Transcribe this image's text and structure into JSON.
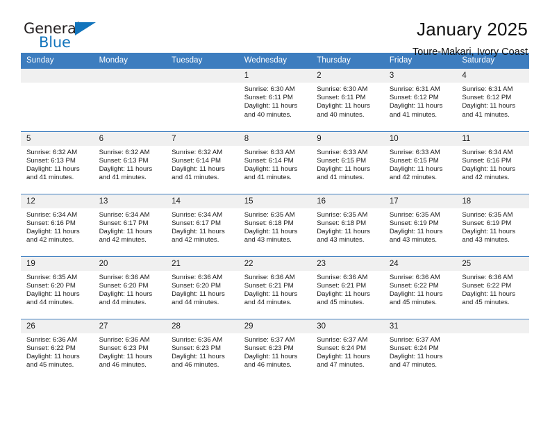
{
  "brand": {
    "name_part1": "General",
    "name_part2": "Blue",
    "accent_color": "#1274bc"
  },
  "header": {
    "title": "January 2025",
    "subtitle": "Toure-Makari, Ivory Coast"
  },
  "theme": {
    "header_row_bg": "#3d7dbf",
    "daynum_bg": "#f0f0f0",
    "grid_line": "#3d7dbf"
  },
  "weekdays": [
    "Sunday",
    "Monday",
    "Tuesday",
    "Wednesday",
    "Thursday",
    "Friday",
    "Saturday"
  ],
  "labels": {
    "sunrise_prefix": "Sunrise:",
    "sunset_prefix": "Sunset:",
    "daylight_prefix": "Daylight:"
  },
  "weeks": [
    [
      {
        "day": "",
        "blank": true
      },
      {
        "day": "",
        "blank": true
      },
      {
        "day": "",
        "blank": true
      },
      {
        "day": "1",
        "sunrise": "Sunrise: 6:30 AM",
        "sunset": "Sunset: 6:11 PM",
        "daylight": "Daylight: 11 hours and 40 minutes."
      },
      {
        "day": "2",
        "sunrise": "Sunrise: 6:30 AM",
        "sunset": "Sunset: 6:11 PM",
        "daylight": "Daylight: 11 hours and 40 minutes."
      },
      {
        "day": "3",
        "sunrise": "Sunrise: 6:31 AM",
        "sunset": "Sunset: 6:12 PM",
        "daylight": "Daylight: 11 hours and 41 minutes."
      },
      {
        "day": "4",
        "sunrise": "Sunrise: 6:31 AM",
        "sunset": "Sunset: 6:12 PM",
        "daylight": "Daylight: 11 hours and 41 minutes."
      }
    ],
    [
      {
        "day": "5",
        "sunrise": "Sunrise: 6:32 AM",
        "sunset": "Sunset: 6:13 PM",
        "daylight": "Daylight: 11 hours and 41 minutes."
      },
      {
        "day": "6",
        "sunrise": "Sunrise: 6:32 AM",
        "sunset": "Sunset: 6:13 PM",
        "daylight": "Daylight: 11 hours and 41 minutes."
      },
      {
        "day": "7",
        "sunrise": "Sunrise: 6:32 AM",
        "sunset": "Sunset: 6:14 PM",
        "daylight": "Daylight: 11 hours and 41 minutes."
      },
      {
        "day": "8",
        "sunrise": "Sunrise: 6:33 AM",
        "sunset": "Sunset: 6:14 PM",
        "daylight": "Daylight: 11 hours and 41 minutes."
      },
      {
        "day": "9",
        "sunrise": "Sunrise: 6:33 AM",
        "sunset": "Sunset: 6:15 PM",
        "daylight": "Daylight: 11 hours and 41 minutes."
      },
      {
        "day": "10",
        "sunrise": "Sunrise: 6:33 AM",
        "sunset": "Sunset: 6:15 PM",
        "daylight": "Daylight: 11 hours and 42 minutes."
      },
      {
        "day": "11",
        "sunrise": "Sunrise: 6:34 AM",
        "sunset": "Sunset: 6:16 PM",
        "daylight": "Daylight: 11 hours and 42 minutes."
      }
    ],
    [
      {
        "day": "12",
        "sunrise": "Sunrise: 6:34 AM",
        "sunset": "Sunset: 6:16 PM",
        "daylight": "Daylight: 11 hours and 42 minutes."
      },
      {
        "day": "13",
        "sunrise": "Sunrise: 6:34 AM",
        "sunset": "Sunset: 6:17 PM",
        "daylight": "Daylight: 11 hours and 42 minutes."
      },
      {
        "day": "14",
        "sunrise": "Sunrise: 6:34 AM",
        "sunset": "Sunset: 6:17 PM",
        "daylight": "Daylight: 11 hours and 42 minutes."
      },
      {
        "day": "15",
        "sunrise": "Sunrise: 6:35 AM",
        "sunset": "Sunset: 6:18 PM",
        "daylight": "Daylight: 11 hours and 43 minutes."
      },
      {
        "day": "16",
        "sunrise": "Sunrise: 6:35 AM",
        "sunset": "Sunset: 6:18 PM",
        "daylight": "Daylight: 11 hours and 43 minutes."
      },
      {
        "day": "17",
        "sunrise": "Sunrise: 6:35 AM",
        "sunset": "Sunset: 6:19 PM",
        "daylight": "Daylight: 11 hours and 43 minutes."
      },
      {
        "day": "18",
        "sunrise": "Sunrise: 6:35 AM",
        "sunset": "Sunset: 6:19 PM",
        "daylight": "Daylight: 11 hours and 43 minutes."
      }
    ],
    [
      {
        "day": "19",
        "sunrise": "Sunrise: 6:35 AM",
        "sunset": "Sunset: 6:20 PM",
        "daylight": "Daylight: 11 hours and 44 minutes."
      },
      {
        "day": "20",
        "sunrise": "Sunrise: 6:36 AM",
        "sunset": "Sunset: 6:20 PM",
        "daylight": "Daylight: 11 hours and 44 minutes."
      },
      {
        "day": "21",
        "sunrise": "Sunrise: 6:36 AM",
        "sunset": "Sunset: 6:20 PM",
        "daylight": "Daylight: 11 hours and 44 minutes."
      },
      {
        "day": "22",
        "sunrise": "Sunrise: 6:36 AM",
        "sunset": "Sunset: 6:21 PM",
        "daylight": "Daylight: 11 hours and 44 minutes."
      },
      {
        "day": "23",
        "sunrise": "Sunrise: 6:36 AM",
        "sunset": "Sunset: 6:21 PM",
        "daylight": "Daylight: 11 hours and 45 minutes."
      },
      {
        "day": "24",
        "sunrise": "Sunrise: 6:36 AM",
        "sunset": "Sunset: 6:22 PM",
        "daylight": "Daylight: 11 hours and 45 minutes."
      },
      {
        "day": "25",
        "sunrise": "Sunrise: 6:36 AM",
        "sunset": "Sunset: 6:22 PM",
        "daylight": "Daylight: 11 hours and 45 minutes."
      }
    ],
    [
      {
        "day": "26",
        "sunrise": "Sunrise: 6:36 AM",
        "sunset": "Sunset: 6:22 PM",
        "daylight": "Daylight: 11 hours and 45 minutes."
      },
      {
        "day": "27",
        "sunrise": "Sunrise: 6:36 AM",
        "sunset": "Sunset: 6:23 PM",
        "daylight": "Daylight: 11 hours and 46 minutes."
      },
      {
        "day": "28",
        "sunrise": "Sunrise: 6:36 AM",
        "sunset": "Sunset: 6:23 PM",
        "daylight": "Daylight: 11 hours and 46 minutes."
      },
      {
        "day": "29",
        "sunrise": "Sunrise: 6:37 AM",
        "sunset": "Sunset: 6:23 PM",
        "daylight": "Daylight: 11 hours and 46 minutes."
      },
      {
        "day": "30",
        "sunrise": "Sunrise: 6:37 AM",
        "sunset": "Sunset: 6:24 PM",
        "daylight": "Daylight: 11 hours and 47 minutes."
      },
      {
        "day": "31",
        "sunrise": "Sunrise: 6:37 AM",
        "sunset": "Sunset: 6:24 PM",
        "daylight": "Daylight: 11 hours and 47 minutes."
      },
      {
        "day": "",
        "blank": true
      }
    ]
  ]
}
